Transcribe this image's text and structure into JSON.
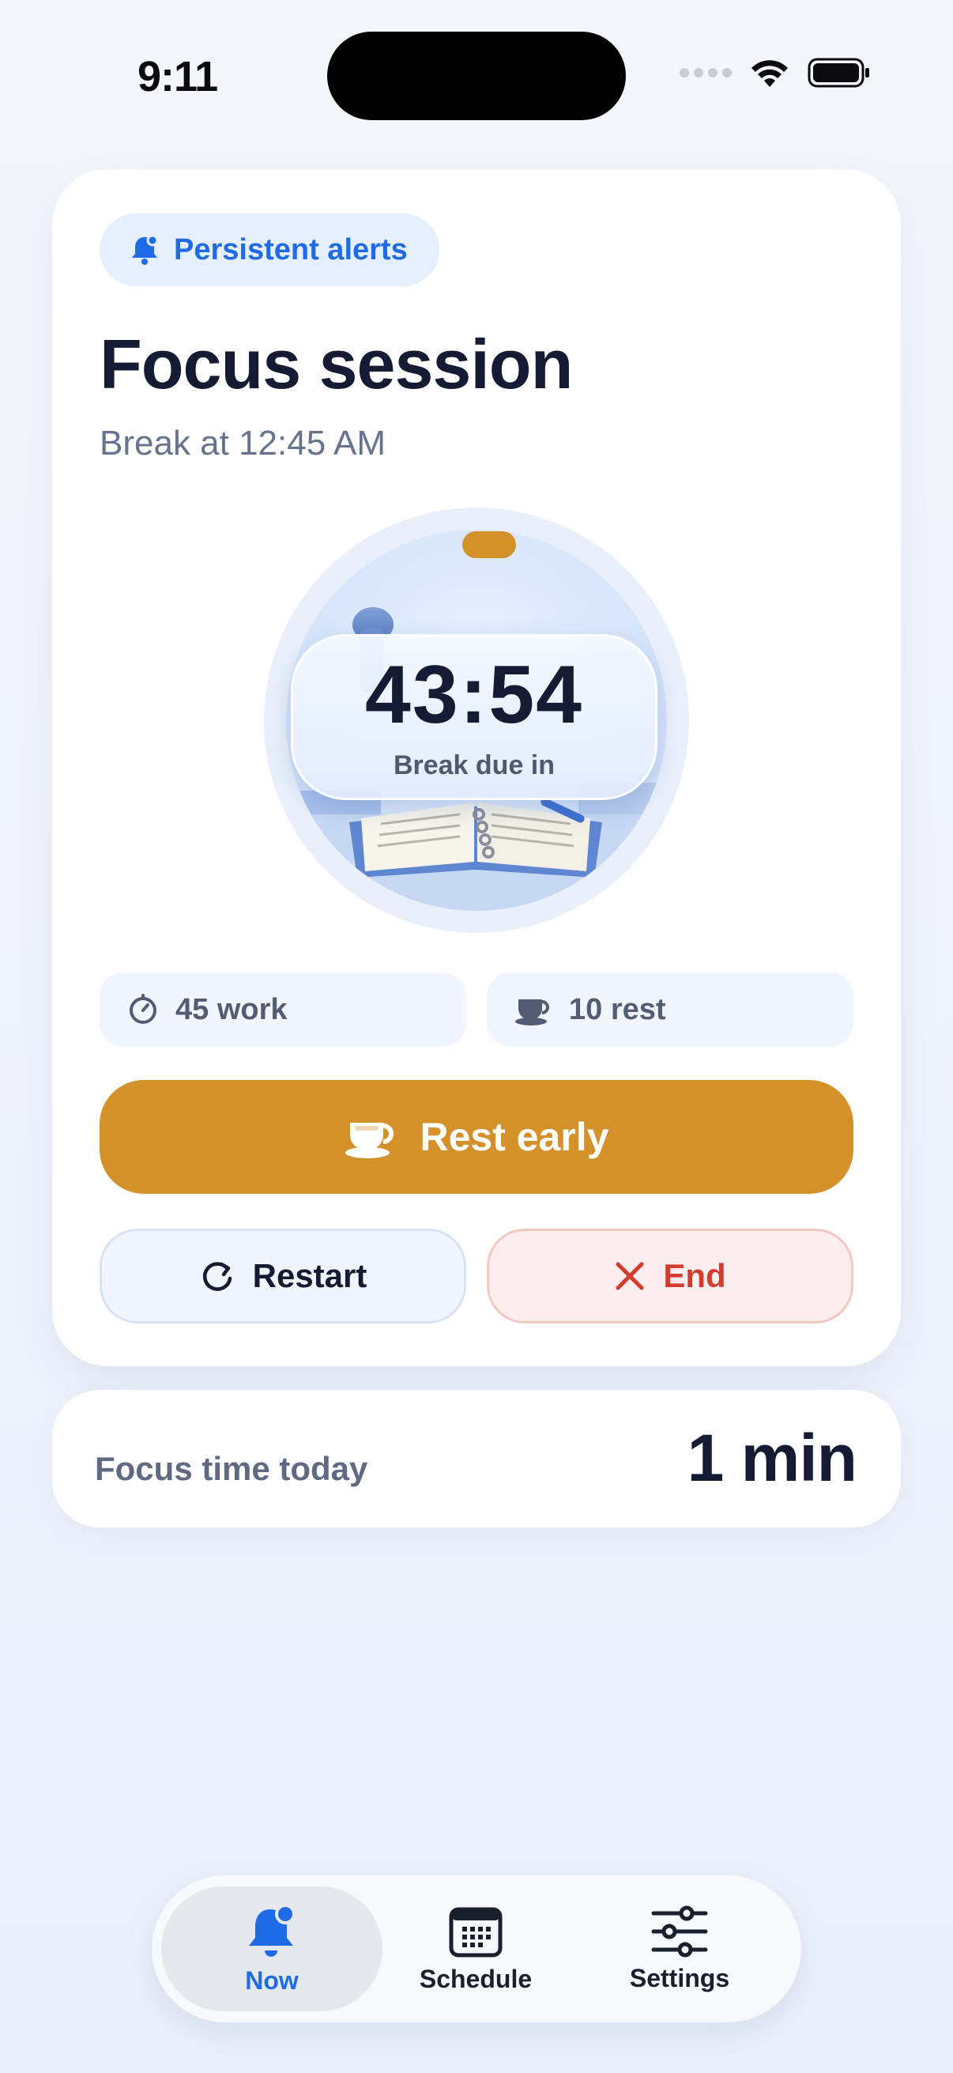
{
  "status_bar": {
    "time": "9:11"
  },
  "card": {
    "badge_label": "Persistent alerts",
    "title": "Focus session",
    "subtitle": "Break at 12:45 AM",
    "timer": {
      "value": "43:54",
      "caption": "Break due in"
    },
    "chips": {
      "work": "45 work",
      "rest": "10 rest"
    },
    "primary_button": "Rest early",
    "restart_button": "Restart",
    "end_button": "End"
  },
  "stats": {
    "label": "Focus time today",
    "value": "1 min"
  },
  "tabs": [
    {
      "label": "Now",
      "icon": "bell-icon",
      "active": true
    },
    {
      "label": "Schedule",
      "icon": "calendar-icon",
      "active": false
    },
    {
      "label": "Settings",
      "icon": "sliders-icon",
      "active": false
    }
  ],
  "colors": {
    "accent_blue": "#1f6ae6",
    "primary_orange": "#d4912a",
    "danger_red": "#d23c2f",
    "text_dark": "#141b33"
  }
}
